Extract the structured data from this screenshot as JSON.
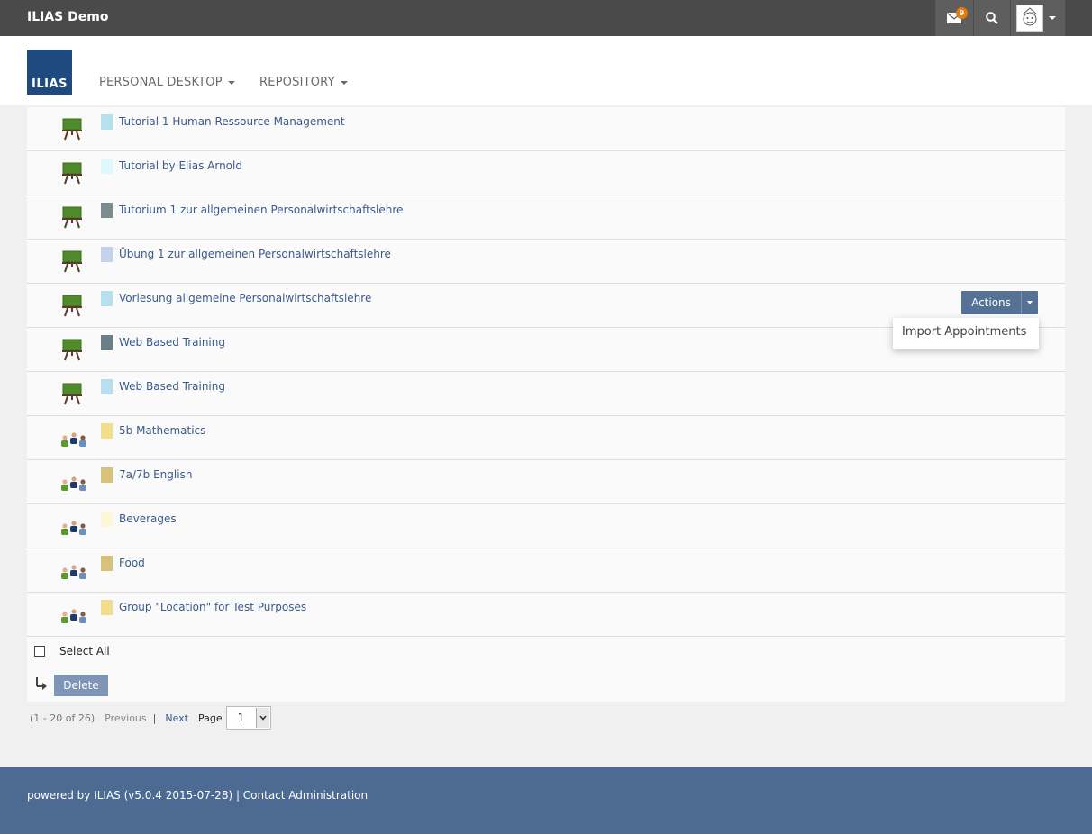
{
  "topbar": {
    "brand": "ILIAS Demo",
    "mail_count": "9"
  },
  "header": {
    "logo_text": "ILIAS",
    "nav": [
      {
        "label": "PERSONAL DESKTOP"
      },
      {
        "label": "REPOSITORY"
      }
    ]
  },
  "list": {
    "items": [
      {
        "title": "Tutorial 1 Human Ressource Management",
        "icon": "tutorial-icon",
        "color": "#b7dff0"
      },
      {
        "title": "Tutorial by Elias Arnold",
        "icon": "tutorial-icon",
        "color": "#dff8fb"
      },
      {
        "title": "Tutorium 1 zur allgemeinen Personalwirtschaftslehre",
        "icon": "tutorial-icon",
        "color": "#7b8b8e"
      },
      {
        "title": "Übung 1 zur allgemeinen Personalwirtschaftslehre",
        "icon": "tutorial-icon",
        "color": "#c3d3ef"
      },
      {
        "title": "Vorlesung allgemeine Personalwirtschaftslehre",
        "icon": "tutorial-icon",
        "color": "#b7dff0"
      },
      {
        "title": "Web Based Training",
        "icon": "tutorial-icon",
        "color": "#6b7f89"
      },
      {
        "title": "Web Based Training",
        "icon": "tutorial-icon",
        "color": "#b7dff0"
      },
      {
        "title": "5b Mathematics",
        "icon": "group-icon",
        "color": "#f0de8c"
      },
      {
        "title": "7a/7b English",
        "icon": "group-icon",
        "color": "#d6c27a"
      },
      {
        "title": "Beverages",
        "icon": "group-icon",
        "color": "#fdf6d8"
      },
      {
        "title": "Food",
        "icon": "group-icon",
        "color": "#d6c27a"
      },
      {
        "title": "Group \"Location\" for Test Purposes",
        "icon": "group-icon",
        "color": "#f0de8c"
      }
    ],
    "actions_label": "Actions",
    "dropdown_item": "Import Appointments",
    "select_all_label": "Select All",
    "delete_label": "Delete"
  },
  "pager": {
    "count": "(1 - 20 of 26)",
    "previous": "Previous",
    "separator": "|",
    "next": "Next",
    "page_label": "Page",
    "page_value": "1"
  },
  "footer": {
    "text": "powered by ILIAS (v5.0.4 2015-07-28) | Contact Administration"
  }
}
